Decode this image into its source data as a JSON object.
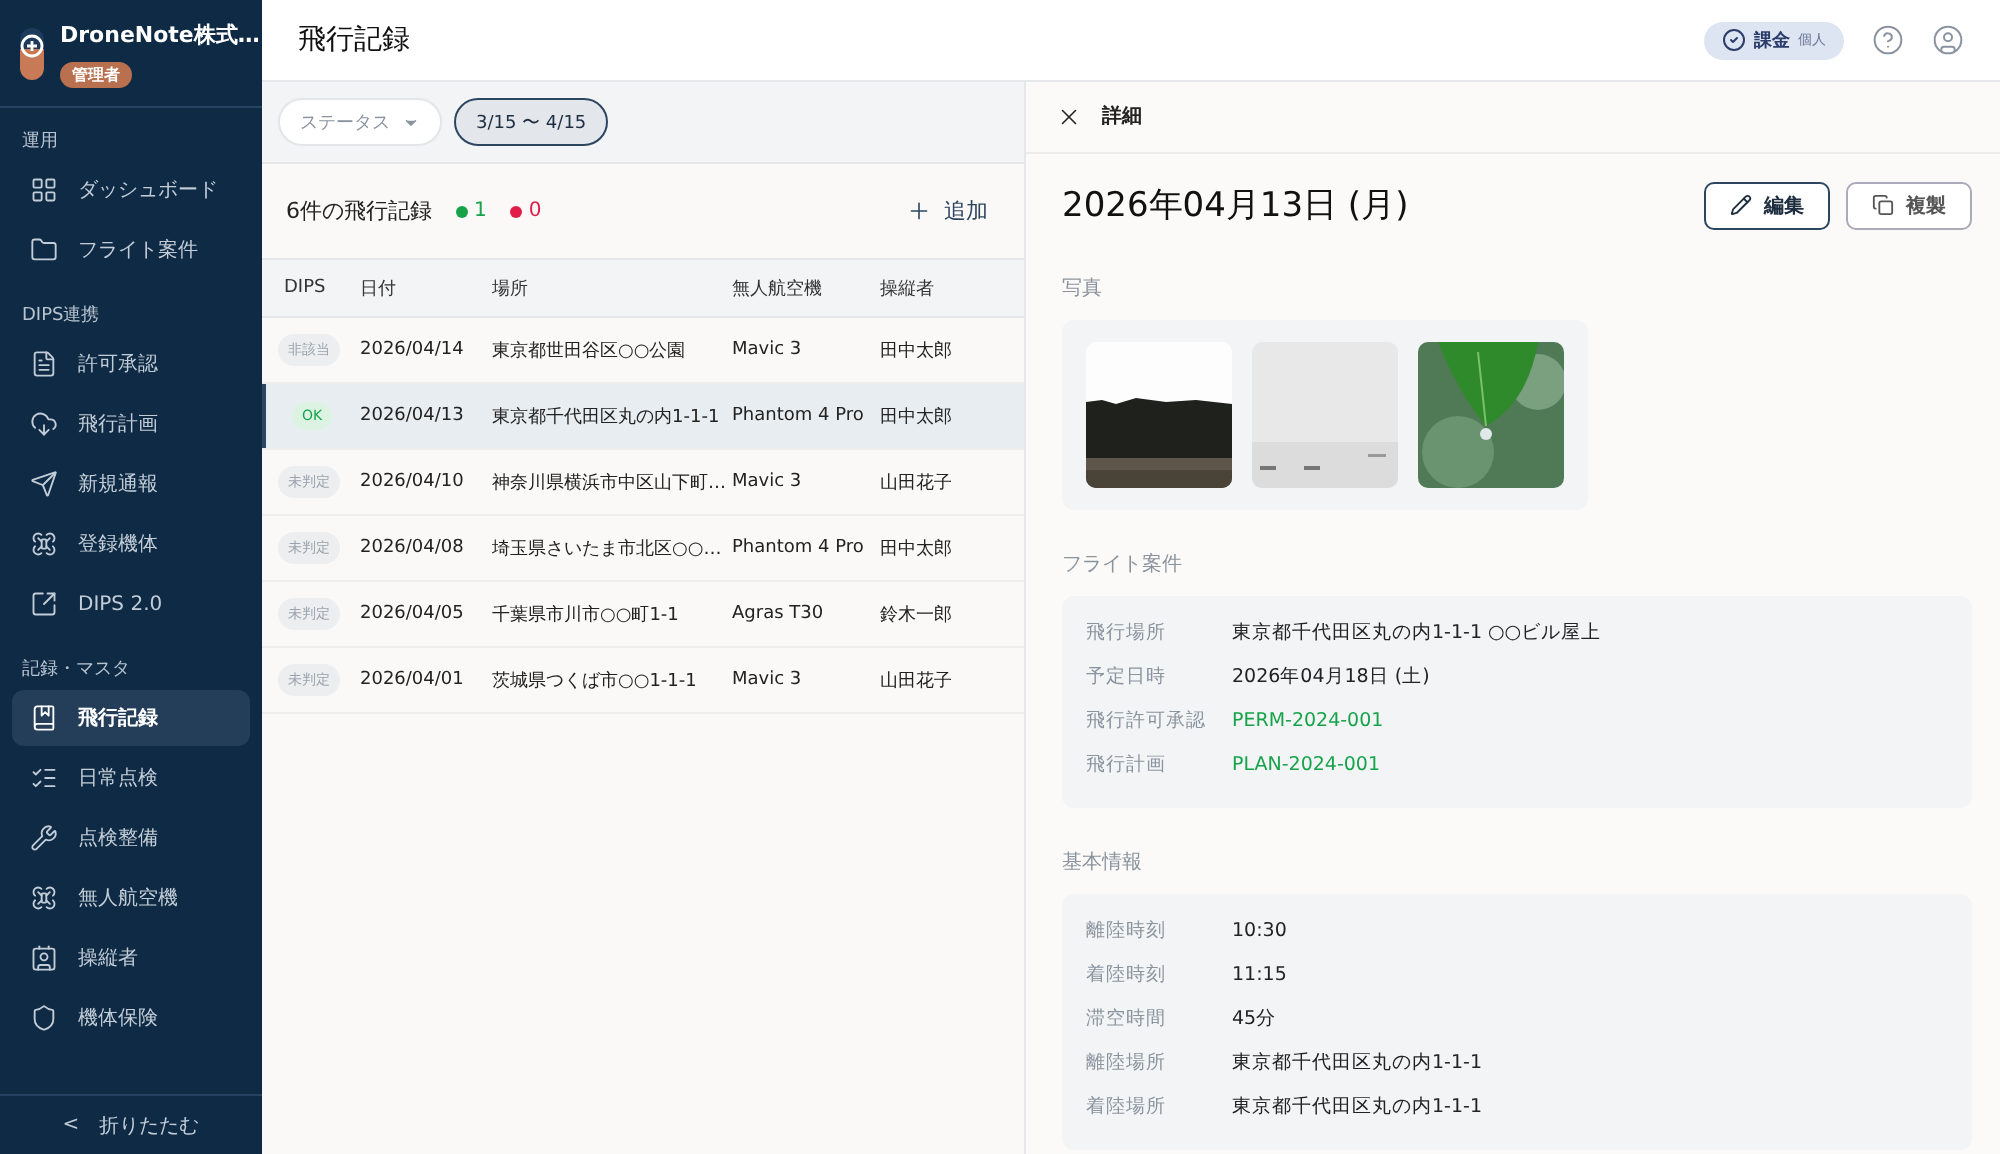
{
  "sidebar": {
    "org": {
      "name": "DroneNote株式…",
      "role": "管理者"
    },
    "sections": [
      {
        "label": "運用",
        "items": [
          {
            "label": "ダッシュボード",
            "selected": false
          },
          {
            "label": "フライト案件",
            "selected": false
          }
        ]
      },
      {
        "label": "DIPS連携",
        "items": [
          {
            "label": "許可承認",
            "selected": false
          },
          {
            "label": "飛行計画",
            "selected": false
          },
          {
            "label": "新規通報",
            "selected": false
          },
          {
            "label": "登録機体",
            "selected": false
          },
          {
            "label": "DIPS 2.0",
            "selected": false
          }
        ]
      },
      {
        "label": "記録・マスタ",
        "items": [
          {
            "label": "飛行記録",
            "selected": true
          },
          {
            "label": "日常点検",
            "selected": false
          },
          {
            "label": "点検整備",
            "selected": false
          },
          {
            "label": "無人航空機",
            "selected": false
          },
          {
            "label": "操縦者",
            "selected": false
          },
          {
            "label": "機体保険",
            "selected": false
          }
        ]
      }
    ],
    "collapse": {
      "arrow": "<",
      "label": "折りたたむ"
    }
  },
  "header": {
    "title": "飛行記録",
    "plan": {
      "label": "課金",
      "sub": "個人"
    }
  },
  "filters": [
    {
      "label": "ステータス",
      "kind": "dropdown",
      "selected": false
    },
    {
      "label": "3/15 〜 4/15",
      "kind": "range",
      "selected": true
    }
  ],
  "list": {
    "title": "6件の飛行記録",
    "stats": [
      {
        "count": "1",
        "color": "#16a34a"
      },
      {
        "count": "0",
        "color": "#e11d48"
      }
    ],
    "add_label": "追加"
  },
  "table": {
    "columns": [
      "DIPS",
      "日付",
      "場所",
      "無人航空機",
      "操縦者"
    ],
    "rows": [
      {
        "dips": "非該当",
        "kind": "na",
        "date": "2026/04/14",
        "place": "東京都世田谷区○○公園",
        "drone": "Mavic 3",
        "pilot": "田中太郎",
        "selected": false
      },
      {
        "dips": "OK",
        "kind": "ok",
        "date": "2026/04/13",
        "place": "東京都千代田区丸の内1-1-1",
        "drone": "Phantom 4 Pro",
        "pilot": "田中太郎",
        "selected": true
      },
      {
        "dips": "未判定",
        "kind": "pending",
        "date": "2026/04/10",
        "place": "神奈川県横浜市中区山下町…",
        "drone": "Mavic 3",
        "pilot": "山田花子",
        "selected": false
      },
      {
        "dips": "未判定",
        "kind": "pending",
        "date": "2026/04/08",
        "place": "埼玉県さいたま市北区○○…",
        "drone": "Phantom 4 Pro",
        "pilot": "田中太郎",
        "selected": false
      },
      {
        "dips": "未判定",
        "kind": "pending",
        "date": "2026/04/05",
        "place": "千葉県市川市○○町1-1",
        "drone": "Agras T30",
        "pilot": "鈴木一郎",
        "selected": false
      },
      {
        "dips": "未判定",
        "kind": "pending",
        "date": "2026/04/01",
        "place": "茨城県つくば市○○1-1-1",
        "drone": "Mavic 3",
        "pilot": "山田花子",
        "selected": false
      }
    ]
  },
  "detail": {
    "title": "詳細",
    "date": "2026年04月13日 (月)",
    "buttons": [
      {
        "label": "編集",
        "kind": "edit"
      },
      {
        "label": "複製",
        "kind": "copy"
      }
    ],
    "photos_label": "写真",
    "groups": [
      {
        "label": "フライト案件",
        "fields": [
          {
            "label": "飛行場所",
            "value": "東京都千代田区丸の内1-1-1 ○○ビル屋上",
            "link": false
          },
          {
            "label": "予定日時",
            "value": "2026年04月18日 (土)",
            "link": false
          },
          {
            "label": "飛行許可承認",
            "value": "PERM-2024-001",
            "link": true
          },
          {
            "label": "飛行計画",
            "value": "PLAN-2024-001",
            "link": true
          }
        ]
      },
      {
        "label": "基本情報",
        "fields": [
          {
            "label": "離陸時刻",
            "value": "10:30",
            "link": false
          },
          {
            "label": "着陸時刻",
            "value": "11:15",
            "link": false
          },
          {
            "label": "滞空時間",
            "value": "45分",
            "link": false
          },
          {
            "label": "離陸場所",
            "value": "東京都千代田区丸の内1-1-1",
            "link": false
          },
          {
            "label": "着陸場所",
            "value": "東京都千代田区丸の内1-1-1",
            "link": false
          }
        ]
      }
    ]
  }
}
